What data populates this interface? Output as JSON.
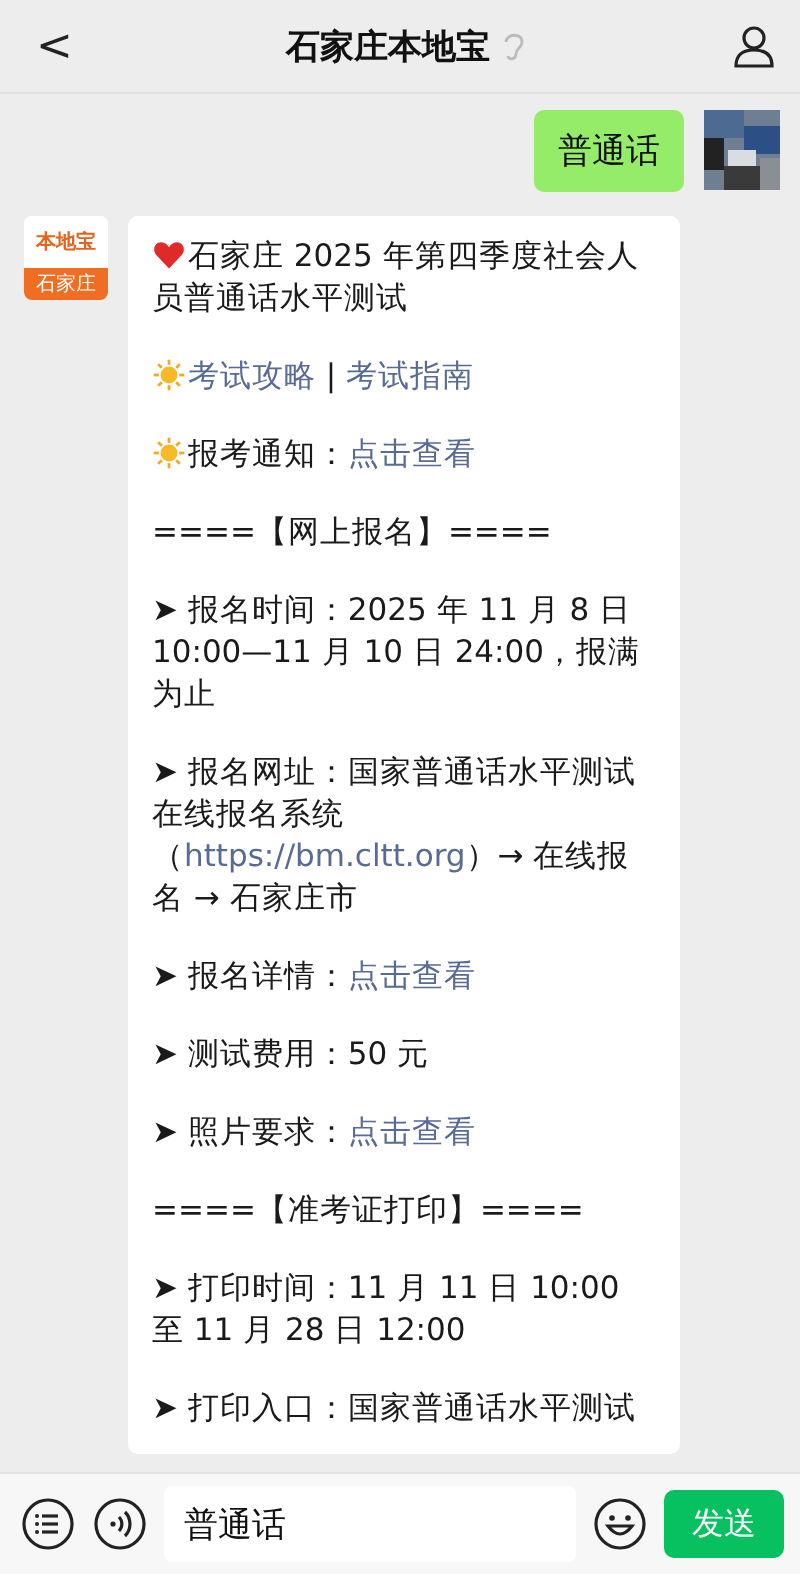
{
  "header": {
    "back": "<",
    "title": "石家庄本地宝"
  },
  "messages": [
    {
      "kind": "sent",
      "text": "普通话"
    },
    {
      "kind": "received",
      "logo_top": "本地宝",
      "logo_bottom": "石家庄",
      "paragraphs": [
        {
          "kind": "heart",
          "segments": [
            {
              "kind": "text",
              "text": "石家庄 2025 年第四季度社会人员普通话水平测试"
            }
          ]
        },
        {
          "kind": "sun",
          "segments": [
            {
              "kind": "link",
              "text": "考试攻略"
            },
            {
              "kind": "text",
              "text": " | "
            },
            {
              "kind": "link",
              "text": "考试指南"
            }
          ]
        },
        {
          "kind": "sun",
          "segments": [
            {
              "kind": "text",
              "text": "报考通知："
            },
            {
              "kind": "link",
              "text": "点击查看"
            }
          ]
        },
        {
          "kind": "plain",
          "segments": [
            {
              "kind": "text",
              "text": "====【网上报名】===="
            }
          ]
        },
        {
          "kind": "plain",
          "segments": [
            {
              "kind": "text",
              "text": "➤ 报名时间：2025 年 11 月 8 日 10:00—11 月 10 日 24:00，报满为止"
            }
          ]
        },
        {
          "kind": "plain",
          "segments": [
            {
              "kind": "text",
              "text": "➤ 报名网址：国家普通话水平测试在线报名系统（"
            },
            {
              "kind": "link",
              "text": "https://bm.cltt.org"
            },
            {
              "kind": "text",
              "text": "）→ 在线报名 → 石家庄市"
            }
          ]
        },
        {
          "kind": "plain",
          "segments": [
            {
              "kind": "text",
              "text": "➤ 报名详情："
            },
            {
              "kind": "link",
              "text": "点击查看"
            }
          ]
        },
        {
          "kind": "plain",
          "segments": [
            {
              "kind": "text",
              "text": "➤ 测试费用：50 元"
            }
          ]
        },
        {
          "kind": "plain",
          "segments": [
            {
              "kind": "text",
              "text": "➤ 照片要求："
            },
            {
              "kind": "link",
              "text": "点击查看"
            }
          ]
        },
        {
          "kind": "plain",
          "segments": [
            {
              "kind": "text",
              "text": "====【准考证打印】===="
            }
          ]
        },
        {
          "kind": "plain",
          "segments": [
            {
              "kind": "text",
              "text": "➤ 打印时间：11 月 11 日 10:00 至 11 月 28 日 12:00"
            }
          ]
        },
        {
          "kind": "plain",
          "segments": [
            {
              "kind": "text",
              "text": "➤ 打印入口：国家普通话水平测试"
            }
          ]
        }
      ]
    }
  ],
  "input": {
    "value": "普通话",
    "send": "发送"
  }
}
